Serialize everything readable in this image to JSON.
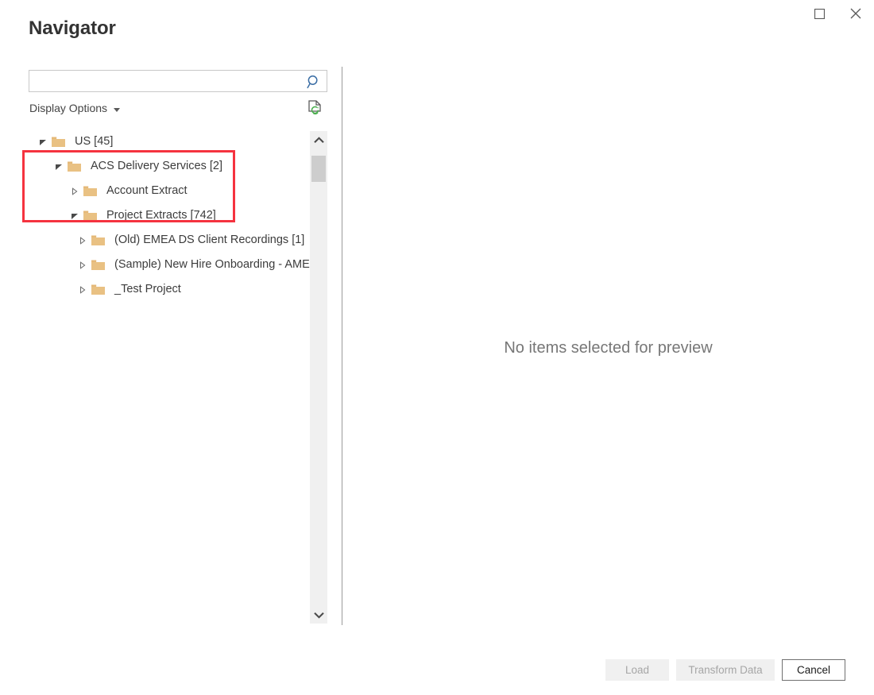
{
  "window": {
    "title": "Navigator",
    "controls": [
      {
        "name": "maximize",
        "icon": "square-icon",
        "label": "Maximize"
      },
      {
        "name": "close",
        "icon": "close-icon",
        "label": "Close"
      }
    ]
  },
  "search": {
    "value": "",
    "placeholder": "",
    "icon": "search-icon",
    "icon_color": "#3b6ea5"
  },
  "options": {
    "display_options_label": "Display Options",
    "caret_icon": "chevron-down-icon",
    "refresh_icon": "refresh-preview-icon",
    "refresh_icon_color": "#4caf50"
  },
  "tree": {
    "nodes": [
      {
        "label": "US [45]",
        "indent": 0,
        "expanded": true,
        "twisty": "triangle-down-filled",
        "hovered": false,
        "highlighted": false
      },
      {
        "label": "ACS Delivery Services [2]",
        "indent": 1,
        "expanded": true,
        "twisty": "triangle-down-filled",
        "hovered": false,
        "highlighted": true
      },
      {
        "label": "Account Extract",
        "indent": 2,
        "expanded": false,
        "twisty": "triangle-right-hollow",
        "hovered": false,
        "highlighted": true
      },
      {
        "label": "Project Extracts [742]",
        "indent": 2,
        "expanded": true,
        "twisty": "triangle-down-filled",
        "hovered": false,
        "highlighted": true
      },
      {
        "label": "(Old) EMEA DS Client Recordings [1]",
        "indent": 3,
        "expanded": false,
        "twisty": "triangle-right-hollow",
        "hovered": true,
        "highlighted": false
      },
      {
        "label": "(Sample) New Hire Onboarding - AMER",
        "indent": 3,
        "expanded": false,
        "twisty": "triangle-right-hollow",
        "hovered": false,
        "highlighted": false
      },
      {
        "label": "_Test Project",
        "indent": 3,
        "expanded": false,
        "twisty": "triangle-right-hollow",
        "hovered": false,
        "highlighted": false
      }
    ],
    "folder_icon": "folder-icon",
    "folder_color": "#e9c183",
    "scrollbar": {
      "up_icon": "chevron-up-icon",
      "down_icon": "chevron-down-icon",
      "thumb_position_percent": 2
    }
  },
  "preview": {
    "empty_message": "No items selected for preview"
  },
  "footer": {
    "load_label": "Load",
    "transform_label": "Transform Data",
    "cancel_label": "Cancel",
    "load_enabled": false,
    "transform_enabled": false,
    "cancel_enabled": true
  },
  "annotation": {
    "color": "#f5333f",
    "shape": "rectangle"
  }
}
